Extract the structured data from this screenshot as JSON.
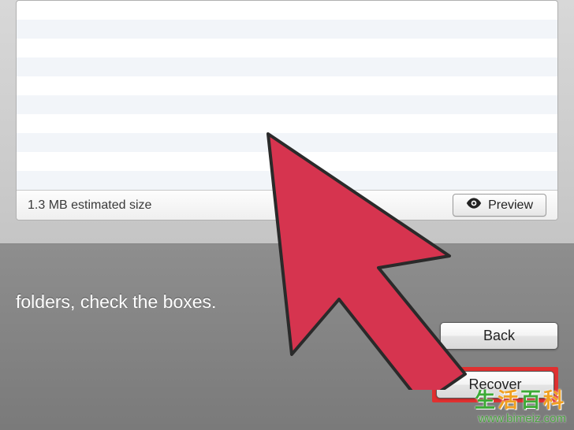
{
  "panel": {
    "size_text": "1.3 MB estimated size",
    "preview_label": "Preview"
  },
  "lower": {
    "instruction": "folders, check the boxes."
  },
  "buttons": {
    "help": "?",
    "back": "Back",
    "recover": "Recover"
  },
  "watermark": {
    "cn": "生活百科",
    "url": "www.bimeiz.com"
  },
  "colors": {
    "arrow_fill": "#d6344f",
    "arrow_stroke": "#2a2a2a",
    "highlight": "#e03030"
  }
}
